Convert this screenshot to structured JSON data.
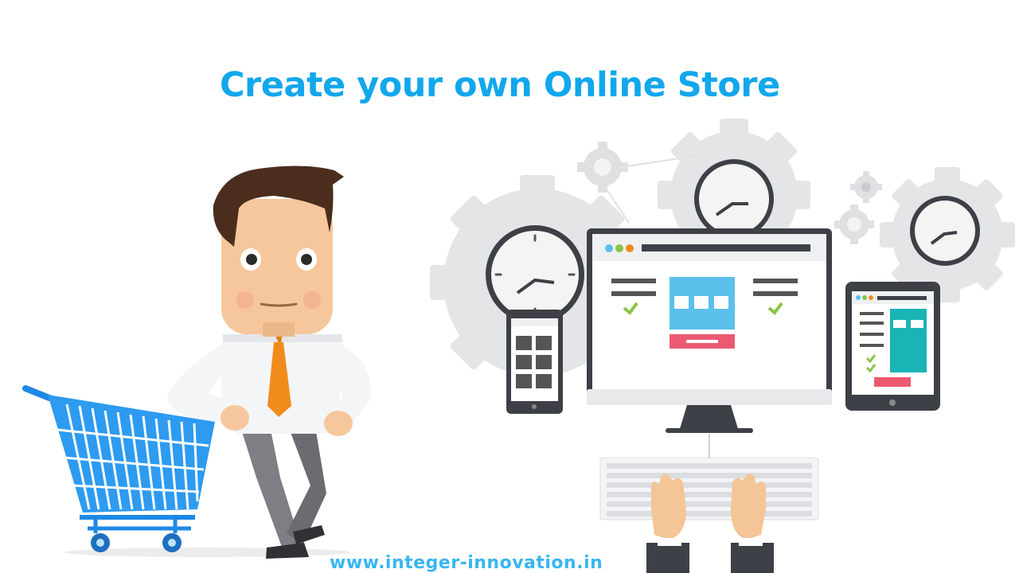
{
  "page": {
    "title": "Create your own Online Store",
    "footer_url": "www.integer-innovation.in"
  },
  "colors": {
    "title": "#12a7ec",
    "footer": "#38b6f0",
    "cart": "#1e88e5",
    "tie": "#f08c1c",
    "gear": "#e6e7e8",
    "screen_accent": "#5bc0eb",
    "button": "#ec5a72",
    "check": "#8bc34a"
  },
  "icons": [
    "man-with-cart-illustration",
    "shopping-cart-icon",
    "gear-icon",
    "clock-icon",
    "desktop-monitor-icon",
    "smartphone-icon",
    "tablet-icon",
    "keyboard-icon",
    "hands-icon"
  ]
}
